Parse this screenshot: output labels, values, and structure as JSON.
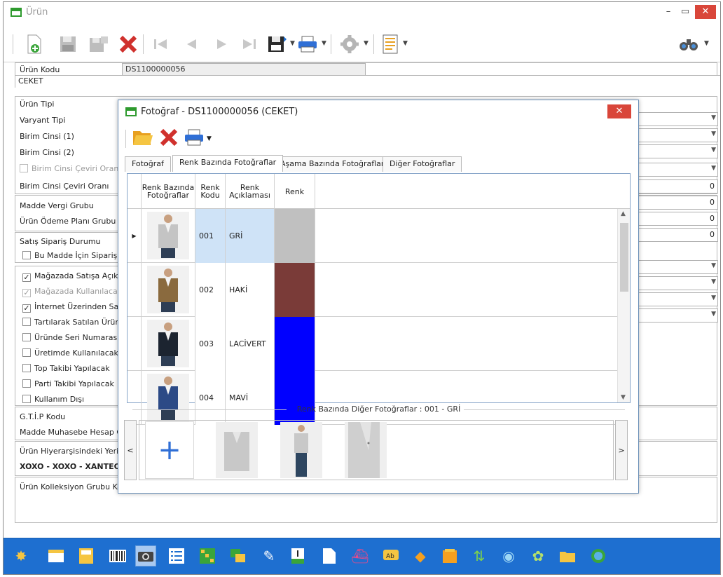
{
  "window": {
    "title": "Ürün",
    "min": "–",
    "max": "▭",
    "close": "✕"
  },
  "form": {
    "code_label": "Ürün Kodu",
    "code_value": "DS1100000056",
    "description_value": "CEKET",
    "labels": {
      "product_type": "Ürün Tipi",
      "variant_type": "Varyant Tipi",
      "unit1": "Birim Cinsi (1)",
      "unit2": "Birim Cinsi (2)",
      "conv_ratio_var": "Birim Cinsi Çeviri Oranı De",
      "conv_ratio": "Birim Cinsi Çeviri Oranı",
      "tax_group": "Madde Vergi Grubu",
      "payment_plan": "Ürün Ödeme Planı Grubu",
      "sales_order_status": "Satış Sipariş Durumu",
      "order_for_item": "Bu Madde İçin Sipariş Ve",
      "store_open": "Mağazada Satışa Açık",
      "store_use": "Mağazada Kullanılacak",
      "internet_sales": "İnternet Üzerinden Satış",
      "weighed": "Tartılarak Satılan Ürün",
      "serial": "Üründe Seri Numarası Ta",
      "production": "Üretimde Kullanılacak",
      "roll_track": "Top Takibi Yapılacak",
      "batch_track": "Parti Takibi Yapılacak",
      "out_of_use": "Kullanım Dışı",
      "gtip": "G.T.İ.P Kodu",
      "accounting": "Madde Muhasebe Hesap Gr",
      "hierarchy": "Ürün Hiyerarşisindeki Yeri",
      "hierarchy_value": "XOXO - XOXO - XANTEON",
      "collection": "Ürün Kolleksiyon Grubu Kodu"
    },
    "right_numbers": [
      "0",
      "0",
      "0",
      "0"
    ]
  },
  "dialog": {
    "title": "Fotoğraf - DS1100000056 (CEKET)",
    "close": "✕",
    "tabs": [
      "Fotoğraf",
      "Renk Bazında Fotoğraflar",
      "Aşama Bazında Fotoğraflar",
      "Diğer Fotoğraflar"
    ],
    "columns": [
      "Renk Bazında Fotoğraflar",
      "Renk Kodu",
      "Renk Açıklaması",
      "Renk"
    ],
    "rows": [
      {
        "code": "001",
        "desc": "GRİ",
        "color": "#c0c0c0",
        "jacket": "#c4c4c4",
        "selected": true
      },
      {
        "code": "002",
        "desc": "HAKİ",
        "color": "#7a3b38",
        "jacket": "#8a6a3e",
        "selected": false
      },
      {
        "code": "003",
        "desc": "LACİVERT",
        "color": "#0000ff",
        "jacket": "#1c2430",
        "selected": false
      },
      {
        "code": "004",
        "desc": "MAVİ",
        "color": "#0000ff",
        "jacket": "#2c4a86",
        "selected": false
      }
    ],
    "gallery_caption": "Renk Bazında Diğer Fotoğraflar : 001 - GRİ",
    "prev": "<",
    "next": ">",
    "add": "+"
  },
  "colors": {
    "accent": "#1e6fd0",
    "close": "#d9463a",
    "selected_row": "#cfe3f7"
  }
}
